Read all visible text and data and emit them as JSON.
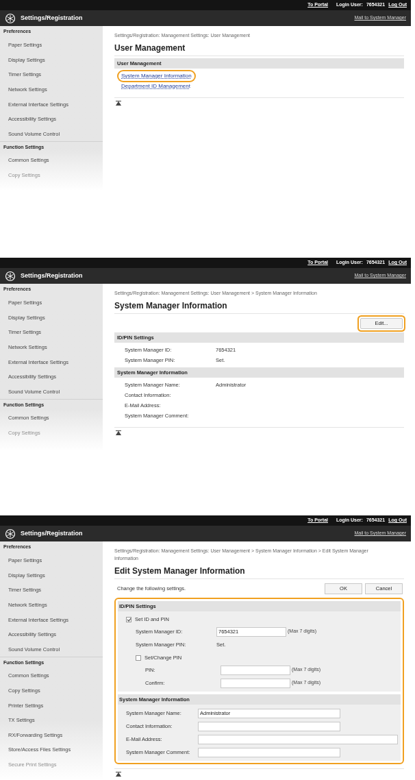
{
  "panels": [
    {
      "top_bar": {
        "portal_link": "To Portal",
        "login_label": "Login User:",
        "login_user": "7654321",
        "logout_link": "Log Out"
      },
      "header": {
        "title": "Settings/Registration",
        "mail_link": "Mail to System Manager"
      },
      "sidebar": [
        {
          "kind": "group",
          "label": "Preferences"
        },
        {
          "kind": "item",
          "label": "Paper Settings",
          "faded": false
        },
        {
          "kind": "item",
          "label": "Display Settings",
          "faded": false
        },
        {
          "kind": "item",
          "label": "Timer Settings",
          "faded": false
        },
        {
          "kind": "item",
          "label": "Network Settings",
          "faded": false
        },
        {
          "kind": "item",
          "label": "External Interface Settings",
          "faded": false
        },
        {
          "kind": "item",
          "label": "Accessibility Settings",
          "faded": false
        },
        {
          "kind": "item",
          "label": "Sound Volume Control",
          "faded": false
        },
        {
          "kind": "group",
          "label": "Function Settings"
        },
        {
          "kind": "item",
          "label": "Common Settings",
          "faded": false
        },
        {
          "kind": "item",
          "label": "Copy Settings",
          "faded": true
        }
      ],
      "breadcrumb": "Settings/Registration: Management Settings: User Management",
      "heading": "User Management",
      "content": [
        {
          "kind": "section",
          "label": "User Management",
          "children": [
            {
              "kind": "link",
              "label": "System Manager Information",
              "highlighted": true
            },
            {
              "kind": "link",
              "label": "Department ID Management",
              "highlighted": false
            }
          ]
        }
      ]
    },
    {
      "top_bar": {
        "portal_link": "To Portal",
        "login_label": "Login User:",
        "login_user": "7654321",
        "logout_link": "Log Out"
      },
      "header": {
        "title": "Settings/Registration",
        "mail_link": "Mail to System Manager"
      },
      "sidebar": [
        {
          "kind": "group",
          "label": "Preferences"
        },
        {
          "kind": "item",
          "label": "Paper Settings",
          "faded": false
        },
        {
          "kind": "item",
          "label": "Display Settings",
          "faded": false
        },
        {
          "kind": "item",
          "label": "Timer Settings",
          "faded": false
        },
        {
          "kind": "item",
          "label": "Network Settings",
          "faded": false
        },
        {
          "kind": "item",
          "label": "External Interface Settings",
          "faded": false
        },
        {
          "kind": "item",
          "label": "Accessibility Settings",
          "faded": false
        },
        {
          "kind": "item",
          "label": "Sound Volume Control",
          "faded": false
        },
        {
          "kind": "group",
          "label": "Function Settings"
        },
        {
          "kind": "item",
          "label": "Common Settings",
          "faded": false
        },
        {
          "kind": "item",
          "label": "Copy Settings",
          "faded": true
        }
      ],
      "breadcrumb": "Settings/Registration: Management Settings: User Management > System Manager Information",
      "heading": "System Manager Information",
      "content": [
        {
          "kind": "toolbar",
          "buttons": [
            {
              "label": "Edit...",
              "highlighted": true
            }
          ]
        },
        {
          "kind": "section",
          "label": "ID/PIN Settings",
          "children": [
            {
              "kind": "row",
              "label": "System Manager ID:",
              "value": "7654321"
            },
            {
              "kind": "row",
              "label": "System Manager PIN:",
              "value": "Set."
            }
          ]
        },
        {
          "kind": "section",
          "label": "System Manager Information",
          "children": [
            {
              "kind": "row",
              "label": "System Manager Name:",
              "value": "Administrator"
            },
            {
              "kind": "row",
              "label": "Contact Information:"
            },
            {
              "kind": "row",
              "label": "E-Mail Address:"
            },
            {
              "kind": "row",
              "label": "System Manager Comment:"
            }
          ]
        }
      ]
    },
    {
      "top_bar": {
        "portal_link": "To Portal",
        "login_label": "Login User:",
        "login_user": "7654321",
        "logout_link": "Log Out"
      },
      "header": {
        "title": "Settings/Registration",
        "mail_link": "Mail to System Manager"
      },
      "sidebar": [
        {
          "kind": "group",
          "label": "Preferences"
        },
        {
          "kind": "item",
          "label": "Paper Settings",
          "faded": false
        },
        {
          "kind": "item",
          "label": "Display Settings",
          "faded": false
        },
        {
          "kind": "item",
          "label": "Timer Settings",
          "faded": false
        },
        {
          "kind": "item",
          "label": "Network Settings",
          "faded": false
        },
        {
          "kind": "item",
          "label": "External Interface Settings",
          "faded": false
        },
        {
          "kind": "item",
          "label": "Accessibility Settings",
          "faded": false
        },
        {
          "kind": "item",
          "label": "Sound Volume Control",
          "faded": false
        },
        {
          "kind": "group",
          "label": "Function Settings"
        },
        {
          "kind": "item",
          "label": "Common Settings",
          "faded": false
        },
        {
          "kind": "item",
          "label": "Copy Settings",
          "faded": false
        },
        {
          "kind": "item",
          "label": "Printer Settings",
          "faded": false
        },
        {
          "kind": "item",
          "label": "TX Settings",
          "faded": false
        },
        {
          "kind": "item",
          "label": "RX/Forwarding Settings",
          "faded": false
        },
        {
          "kind": "item",
          "label": "Store/Access Files Settings",
          "faded": false
        },
        {
          "kind": "item",
          "label": "Secure Print Settings",
          "faded": true
        }
      ],
      "breadcrumb": "Settings/Registration: Management Settings: User Management > System Manager Information > Edit System Manager Information",
      "heading": "Edit System Manager Information",
      "content": [
        {
          "kind": "toolbar",
          "text": "Change the following settings.",
          "buttons": [
            {
              "label": "OK",
              "highlighted": false
            },
            {
              "label": "Cancel",
              "highlighted": false
            }
          ]
        },
        {
          "kind": "group",
          "highlighted": true,
          "children": [
            {
              "kind": "form_section",
              "label": "ID/PIN Settings",
              "children": [
                {
                  "kind": "checkbox",
                  "label": "Set ID and PIN",
                  "checked": true,
                  "children": [
                    {
                      "kind": "field",
                      "label": "System Manager ID:",
                      "value": "7654321",
                      "note": "(Max 7 digits)",
                      "wide": false
                    },
                    {
                      "kind": "row",
                      "label": "System Manager PIN:",
                      "value": "Set."
                    },
                    {
                      "kind": "checkbox",
                      "label": "Set/Change PIN",
                      "checked": false,
                      "children": [
                        {
                          "kind": "field",
                          "label": "PIN:",
                          "note": "(Max 7 digits)",
                          "wide": false
                        },
                        {
                          "kind": "field",
                          "label": "Confirm:",
                          "note": "(Max 7 digits)",
                          "wide": false
                        }
                      ]
                    }
                  ]
                }
              ]
            },
            {
              "kind": "form_section",
              "label": "System Manager Information",
              "children": [
                {
                  "kind": "field",
                  "label": "System Manager Name:",
                  "value": "Administrator",
                  "wide": false
                },
                {
                  "kind": "field",
                  "label": "Contact Information:",
                  "wide": false
                },
                {
                  "kind": "field",
                  "label": "E-Mail Address:",
                  "wide": true
                },
                {
                  "kind": "field",
                  "label": "System Manager Comment:",
                  "wide": false
                }
              ]
            }
          ]
        }
      ]
    }
  ]
}
